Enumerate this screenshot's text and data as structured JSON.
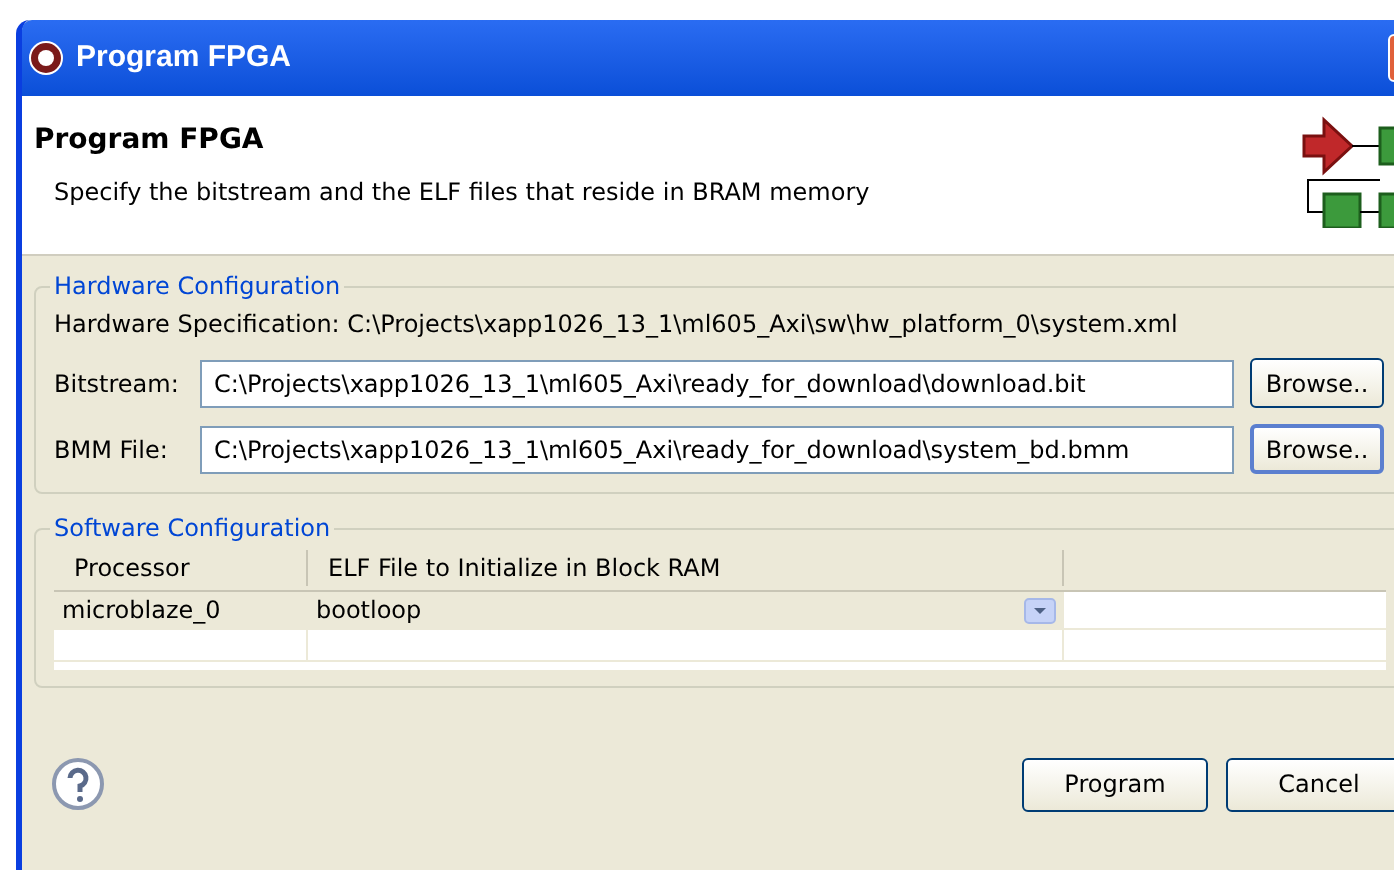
{
  "window": {
    "title": "Program FPGA"
  },
  "header": {
    "title": "Program FPGA",
    "description": "Specify the bitstream and the ELF files that reside in BRAM memory"
  },
  "hardware": {
    "legend": "Hardware Configuration",
    "specification": "Hardware Specification: C:\\Projects\\xapp1026_13_1\\ml605_Axi\\sw\\hw_platform_0\\system.xml",
    "fields": [
      {
        "label": "Bitstream:",
        "value": "C:\\Projects\\xapp1026_13_1\\ml605_Axi\\ready_for_download\\download.bit",
        "button": "Browse..",
        "focused": false
      },
      {
        "label": "BMM File:",
        "value": "C:\\Projects\\xapp1026_13_1\\ml605_Axi\\ready_for_download\\system_bd.bmm",
        "button": "Browse..",
        "focused": true
      }
    ]
  },
  "software": {
    "legend": "Software Configuration",
    "columns": [
      "Processor",
      "ELF File to Initialize in Block RAM"
    ],
    "rows": [
      {
        "processor": "microblaze_0",
        "elf": "bootloop",
        "selected": true
      }
    ]
  },
  "buttons": [
    "Program",
    "Cancel"
  ]
}
